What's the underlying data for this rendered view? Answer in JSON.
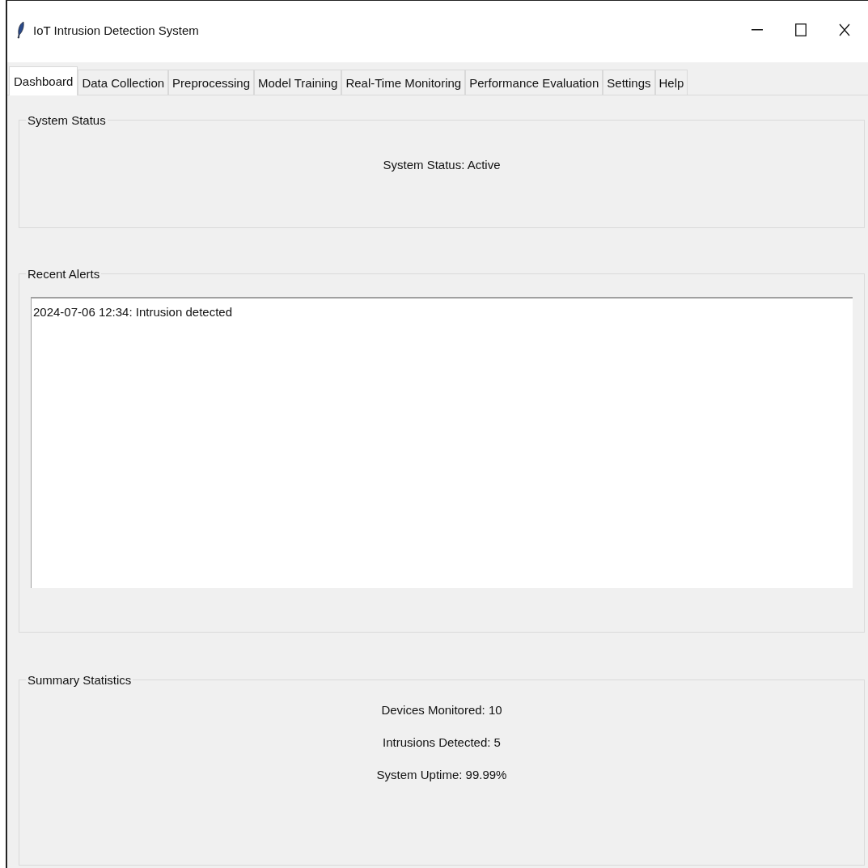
{
  "window": {
    "title": "IoT Intrusion Detection System"
  },
  "tabs": [
    {
      "label": "Dashboard",
      "selected": true
    },
    {
      "label": "Data Collection",
      "selected": false
    },
    {
      "label": "Preprocessing",
      "selected": false
    },
    {
      "label": "Model Training",
      "selected": false
    },
    {
      "label": "Real-Time Monitoring",
      "selected": false
    },
    {
      "label": "Performance Evaluation",
      "selected": false
    },
    {
      "label": "Settings",
      "selected": false
    },
    {
      "label": "Help",
      "selected": false
    }
  ],
  "system_status": {
    "title": "System Status",
    "text": "System Status: Active"
  },
  "recent_alerts": {
    "title": "Recent Alerts",
    "items": [
      "2024-07-06 12:34: Intrusion detected"
    ]
  },
  "summary_statistics": {
    "title": "Summary Statistics",
    "lines": [
      "Devices Monitored: 10",
      "Intrusions Detected: 5",
      "System Uptime: 99.99%"
    ]
  }
}
